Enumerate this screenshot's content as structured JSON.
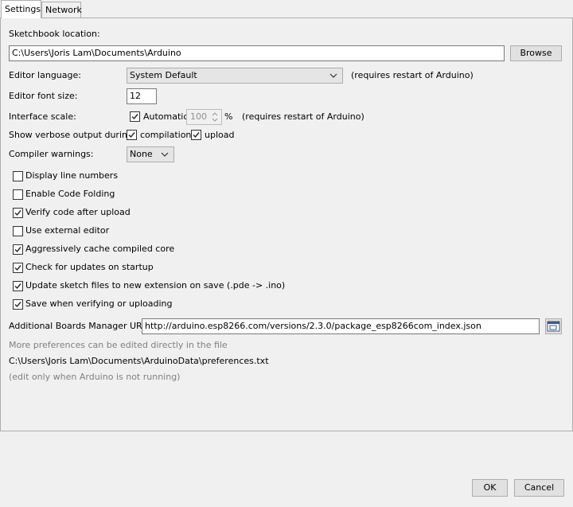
{
  "tabs": [
    {
      "label": "Settings"
    },
    {
      "label": "Network"
    }
  ],
  "sketchbook": {
    "label": "Sketchbook location:",
    "value": "C:\\Users\\Joris Lam\\Documents\\Arduino",
    "browse_label": "Browse"
  },
  "editor_language": {
    "label": "Editor language:",
    "value": "System Default",
    "note": "(requires restart of Arduino)"
  },
  "font_size": {
    "label": "Editor font size:",
    "value": "12"
  },
  "interface_scale": {
    "label": "Interface scale:",
    "automatic_label": "Automatic",
    "automatic_checked": true,
    "value": "100",
    "unit": "%",
    "note": "(requires restart of Arduino)"
  },
  "verbose": {
    "label": "Show verbose output during:",
    "compilation_label": "compilation",
    "compilation_checked": true,
    "upload_label": "upload",
    "upload_checked": true
  },
  "compiler_warnings": {
    "label": "Compiler warnings:",
    "value": "None"
  },
  "options": [
    {
      "label": "Display line numbers",
      "checked": false
    },
    {
      "label": "Enable Code Folding",
      "checked": false
    },
    {
      "label": "Verify code after upload",
      "checked": true
    },
    {
      "label": "Use external editor",
      "checked": false
    },
    {
      "label": "Aggressively cache compiled core",
      "checked": true
    },
    {
      "label": "Check for updates on startup",
      "checked": true
    },
    {
      "label": "Update sketch files to new extension on save (.pde -> .ino)",
      "checked": true
    },
    {
      "label": "Save when verifying or uploading",
      "checked": true
    }
  ],
  "boards_urls": {
    "label": "Additional Boards Manager URLs:",
    "value": "http://arduino.esp8266.com/versions/2.3.0/package_esp8266com_index.json"
  },
  "footer": {
    "more_prefs": "More preferences can be edited directly in the file",
    "prefs_path": "C:\\Users\\Joris Lam\\Documents\\ArduinoData\\preferences.txt",
    "edit_note": "(edit only when Arduino is not running)"
  },
  "buttons": {
    "ok_label": "OK",
    "cancel_label": "Cancel"
  }
}
